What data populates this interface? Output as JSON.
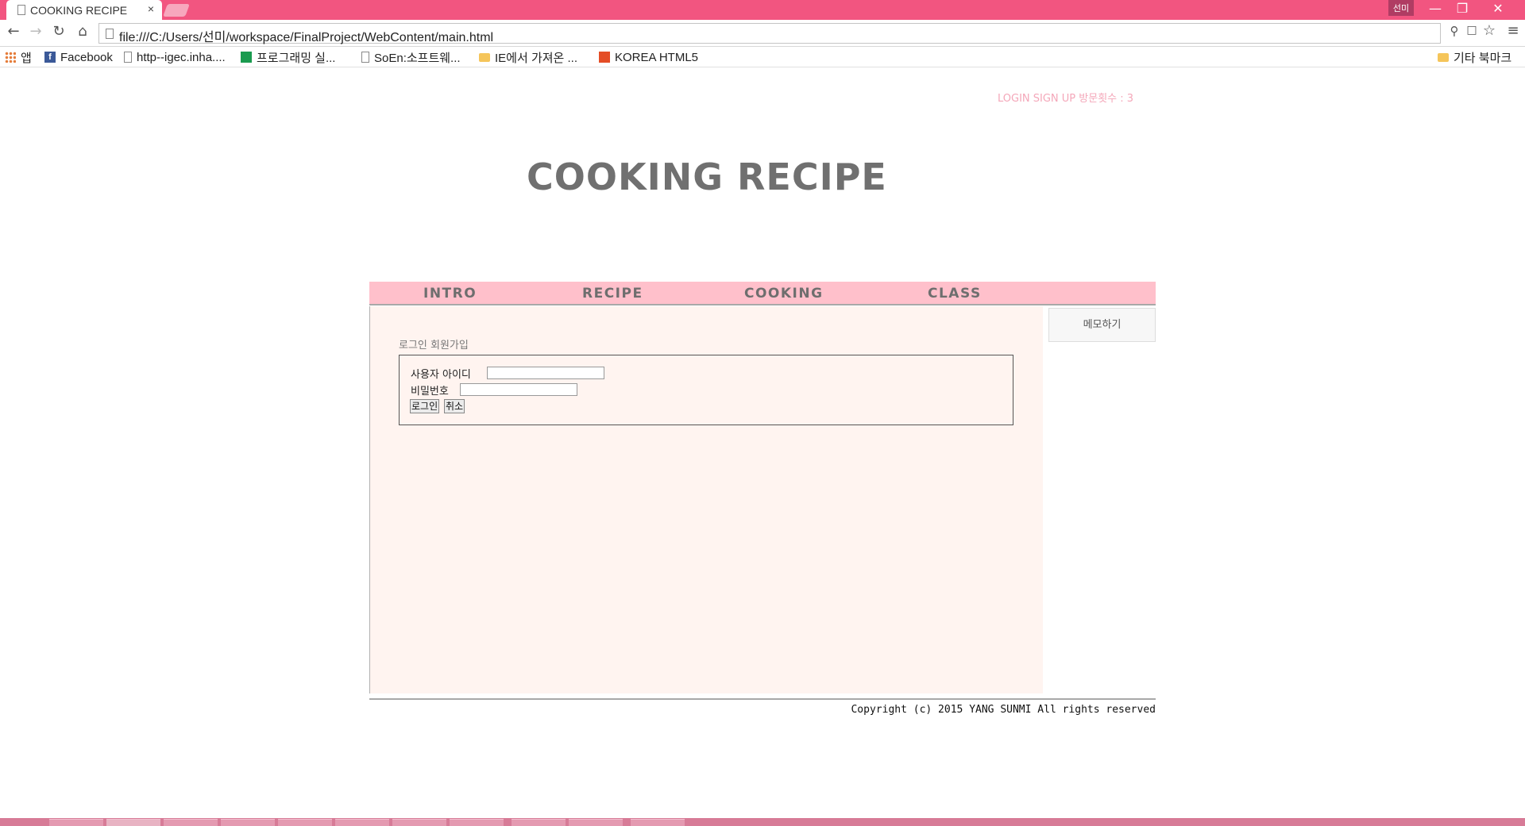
{
  "browser": {
    "tab_title": "COOKING RECIPE",
    "tab_close": "×",
    "user_badge": "선미",
    "url": "file:///C:/Users/선미/workspace/FinalProject/WebContent/main.html",
    "bookmarks": [
      {
        "label": "앱",
        "icon": "apps-icon"
      },
      {
        "label": "Facebook",
        "icon": "facebook-icon"
      },
      {
        "label": "http--igec.inha....",
        "icon": "page-icon"
      },
      {
        "label": "프로그래밍 실...",
        "icon": "spreadsheet-icon"
      },
      {
        "label": "SoEn:소프트웨...",
        "icon": "page-icon"
      },
      {
        "label": "IE에서 가져온 ...",
        "icon": "folder-icon"
      },
      {
        "label": "KOREA HTML5",
        "icon": "html5-icon"
      }
    ],
    "other_bookmarks": "기타 북마크"
  },
  "header": {
    "top_links": "LOGIN SIGN UP 방문횟수 : 3",
    "site_title": "COOKING RECIPE"
  },
  "menu": {
    "items": [
      "INTRO",
      "RECIPE",
      "COOKING",
      "CLASS"
    ]
  },
  "sidebar": {
    "memo_button": "메모하기"
  },
  "login": {
    "caption": "로그인 회원가입",
    "user_id_label": "사용자 아이디",
    "user_id_value": "",
    "password_label": "비밀번호",
    "password_value": "",
    "login_button": "로그인",
    "cancel_button": "취소"
  },
  "footer": {
    "copyright": "Copyright (c) 2015 YANG SUNMI All rights reserved"
  },
  "colors": {
    "titlebar": "#f25580",
    "menubar": "#ffc0cb",
    "content_bg": "#fff4f0",
    "title_text": "#707070",
    "top_links": "#f4a7b9"
  }
}
